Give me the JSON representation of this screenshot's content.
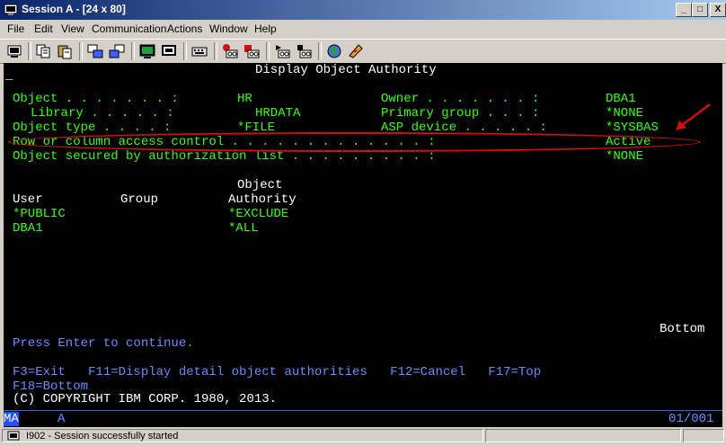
{
  "window": {
    "title": "Session A - [24 x 80]",
    "buttons": [
      "_",
      "□",
      "X"
    ]
  },
  "menu": [
    "File",
    "Edit",
    "View",
    "Communication",
    "Actions",
    "Window",
    "Help"
  ],
  "toolbar": [
    "print-screen-icon",
    "copy-icon",
    "paste-icon",
    "send-icon",
    "receive-icon",
    "display-icon",
    "macro-icon",
    "keyboard-icon",
    "record-macro-icon",
    "play-macro-icon",
    "stop-macro-icon",
    "run-icon",
    "web-icon",
    "help-icon"
  ],
  "screen": {
    "title": "Display Object Authority",
    "object_label": "Object . . . . . . . :",
    "object_value": "HR",
    "library_label": "Library . . . . . :",
    "library_value": "HRDATA",
    "object_type_label": "Object type . . . . :",
    "object_type_value": "*FILE",
    "owner_label": "Owner . . . . . . . :",
    "owner_value": "DBA1",
    "primary_group_label": "Primary group . . . :",
    "primary_group_value": "*NONE",
    "asp_device_label": "ASP device . . . . . :",
    "asp_device_value": "*SYSBAS",
    "rcac_label": "Row or column access control . . . . . . . . . . . . . :",
    "rcac_value": "Active",
    "auth_list_label": "Object secured by authorization list . . . . . . . . . :",
    "auth_list_value": "*NONE",
    "col_object": "Object",
    "col_user": "User",
    "col_group": "Group",
    "col_authority": "Authority",
    "rows": [
      {
        "user": "*PUBLIC",
        "group": "",
        "authority": "*EXCLUDE"
      },
      {
        "user": "DBA1",
        "group": "",
        "authority": "*ALL"
      }
    ],
    "bottom_marker": "Bottom",
    "prompt": "Press Enter to continue.",
    "fkeys_line1": "F3=Exit   F11=Display detail object authorities   F12=Cancel   F17=Top",
    "fkeys_line2": "F18=Bottom",
    "copyright": "(C) COPYRIGHT IBM CORP. 1980, 2013."
  },
  "oia": {
    "mode": "MA",
    "field": "A",
    "position": "01/001"
  },
  "status": {
    "message": "I902 - Session successfully started"
  },
  "colors": {
    "field_green": "#39ff14",
    "text_white": "#ffffff",
    "info_blue": "#6c8cff",
    "annotation_red": "#d01010"
  }
}
